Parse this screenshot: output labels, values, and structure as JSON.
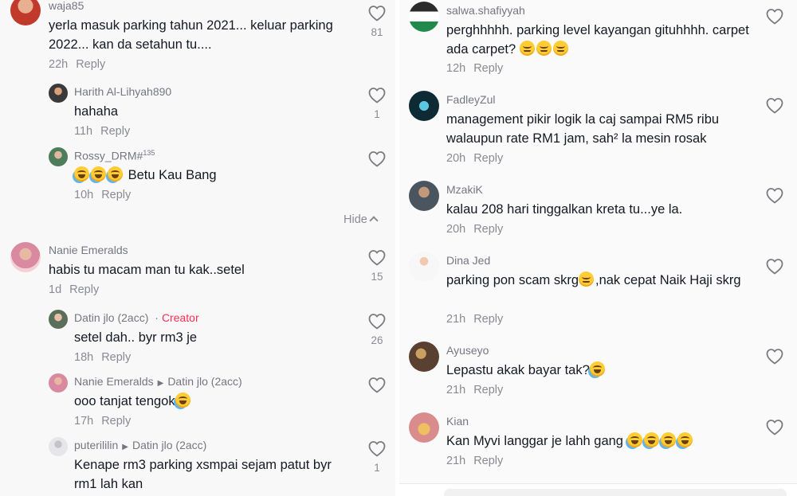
{
  "colors": {
    "creator": "#fe2c55",
    "meta": "#8a8b91",
    "username": "#757680",
    "text": "#161823"
  },
  "heart_icon": "heart-outline-icon",
  "left": {
    "comments": [
      {
        "username": "waja85",
        "text": "yerla masuk parking tahun 2021... keluar parking 2022... kan da setahun tu....",
        "time": "22h",
        "reply": "Reply",
        "likes": "81"
      },
      {
        "username": "Harith Al-Lihyah890",
        "text": "hahaha",
        "time": "11h",
        "reply": "Reply",
        "likes": "1"
      },
      {
        "username": "Rossy_DRM#",
        "username_sup": "135",
        "text": "Betu Kau Bang",
        "time": "10h",
        "reply": "Reply",
        "likes": ""
      },
      {
        "username": "Nanie Emeralds",
        "text": "habis tu macam man tu kak..setel",
        "time": "1d",
        "reply": "Reply",
        "likes": "15"
      },
      {
        "username": "Datin jlo (2acc)",
        "creator_sep": "·",
        "creator_label": "Creator",
        "text": "setel dah.. byr rm3 je",
        "time": "18h",
        "reply": "Reply",
        "likes": "26"
      },
      {
        "username": "Nanie Emeralds",
        "reply_to": "Datin jlo (2acc)",
        "text": "ooo tanjat tengok",
        "time": "17h",
        "reply": "Reply",
        "likes": ""
      },
      {
        "username": "puterililin",
        "reply_to": "Datin jlo (2acc)",
        "text": "Kenape rm3 parking xsmpai sejam patut byr rm1 lah kan",
        "time": "",
        "reply": "",
        "likes": "1"
      }
    ],
    "hide_label": "Hide"
  },
  "right": {
    "comments": [
      {
        "username": "salwa.shafiyyah",
        "text": "perghhhhh. parking level kayangan gituhhhh. carpet ada carpet?",
        "time": "12h",
        "reply": "Reply",
        "likes": ""
      },
      {
        "username": "FadleyZul",
        "text": "management pikir logik la caj sampai RM5 ribu walaupun rate RM1 jam, sah² la mesin rosak",
        "time": "20h",
        "reply": "Reply",
        "likes": ""
      },
      {
        "username": "MzakiK",
        "text": "kalau 208 hari tinggalkan kreta tu...ye la.",
        "time": "20h",
        "reply": "Reply",
        "likes": ""
      },
      {
        "username": "Dina Jed",
        "text": "parking pon scam skrg",
        "text2": ",nak cepat Naik Haji skrg",
        "time": "21h",
        "reply": "Reply",
        "likes": ""
      },
      {
        "username": "Ayuseyo",
        "text": "Lepastu akak bayar tak?",
        "time": "21h",
        "reply": "Reply",
        "likes": ""
      },
      {
        "username": "Kian",
        "text": "Kan Myvi langgar je lahh gang",
        "time": "21h",
        "reply": "Reply",
        "likes": ""
      }
    ]
  }
}
